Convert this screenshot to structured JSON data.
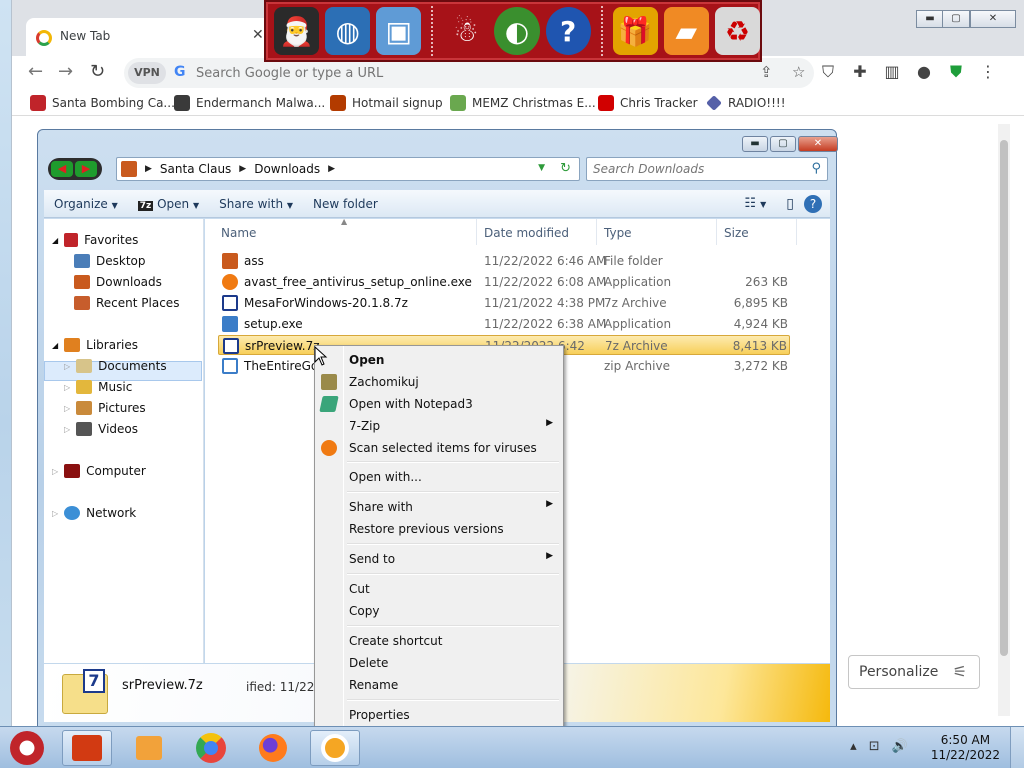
{
  "browser": {
    "tab_title": "New Tab",
    "address_placeholder": "Search Google or type a URL",
    "vpn_label": "VPN",
    "bookmarks": [
      {
        "label": "Santa Bombing Ca...",
        "color": "#c0242a"
      },
      {
        "label": "Endermanch Malwa...",
        "color": "#3a3a3a"
      },
      {
        "label": "Hotmail signup",
        "color": "#b33b00"
      },
      {
        "label": "MEMZ Christmas E...",
        "color": "#6aa84f"
      },
      {
        "label": "Chris Tracker",
        "color": "#d10000"
      },
      {
        "label": "RADIO!!!!",
        "color": "#5560a8"
      }
    ],
    "personalize_label": "Personalize"
  },
  "gift_toolbar": {
    "icons": [
      "santa-computer",
      "globe",
      "network-window",
      "snowman",
      "chrome-shield",
      "help",
      "gift",
      "folder",
      "recycle-bin"
    ]
  },
  "explorer": {
    "breadcrumb": [
      "Santa Claus",
      "Downloads"
    ],
    "search_placeholder": "Search Downloads",
    "commands": {
      "organize": "Organize",
      "open": "Open",
      "share": "Share with",
      "new_folder": "New folder"
    },
    "nav": {
      "favorites": "Favorites",
      "desktop": "Desktop",
      "downloads": "Downloads",
      "recent": "Recent Places",
      "libraries": "Libraries",
      "documents": "Documents",
      "music": "Music",
      "pictures": "Pictures",
      "videos": "Videos",
      "computer": "Computer",
      "network": "Network"
    },
    "columns": {
      "name": "Name",
      "date": "Date modified",
      "type": "Type",
      "size": "Size"
    },
    "files": [
      {
        "name": "ass",
        "date": "11/22/2022 6:46 AM",
        "type": "File folder",
        "size": "",
        "icon": "#c95a1e"
      },
      {
        "name": "avast_free_antivirus_setup_online.exe",
        "date": "11/22/2022 6:08 AM",
        "type": "Application",
        "size": "263 KB",
        "icon": "#f07a12"
      },
      {
        "name": "MesaForWindows-20.1.8.7z",
        "date": "11/21/2022 4:38 PM",
        "type": "7z Archive",
        "size": "6,895 KB",
        "icon": "#1c3a8b"
      },
      {
        "name": "setup.exe",
        "date": "11/22/2022 6:38 AM",
        "type": "Application",
        "size": "4,924 KB",
        "icon": "#3b7dc8"
      },
      {
        "name": "srPreview.7z",
        "date": "11/22/2022 6:42",
        "type": "7z Archive",
        "size": "8,413 KB",
        "icon": "#1c3a8b"
      },
      {
        "name": "TheEntireGoa",
        "date": "PM",
        "type": "zip Archive",
        "size": "3,272 KB",
        "icon": "#3b7dc8"
      }
    ],
    "details": {
      "filename": "srPreview.7z",
      "modified": "ified:  11/22/"
    }
  },
  "context_menu": {
    "items": [
      "Open",
      "Zachomikuj",
      "Open with Notepad3",
      "7-Zip",
      "Scan selected items for viruses",
      "Open with...",
      "Share with",
      "Restore previous versions",
      "Send to",
      "Cut",
      "Copy",
      "Create shortcut",
      "Delete",
      "Rename",
      "Properties"
    ]
  },
  "taskbar": {
    "time": "6:50 AM",
    "date": "11/22/2022"
  }
}
